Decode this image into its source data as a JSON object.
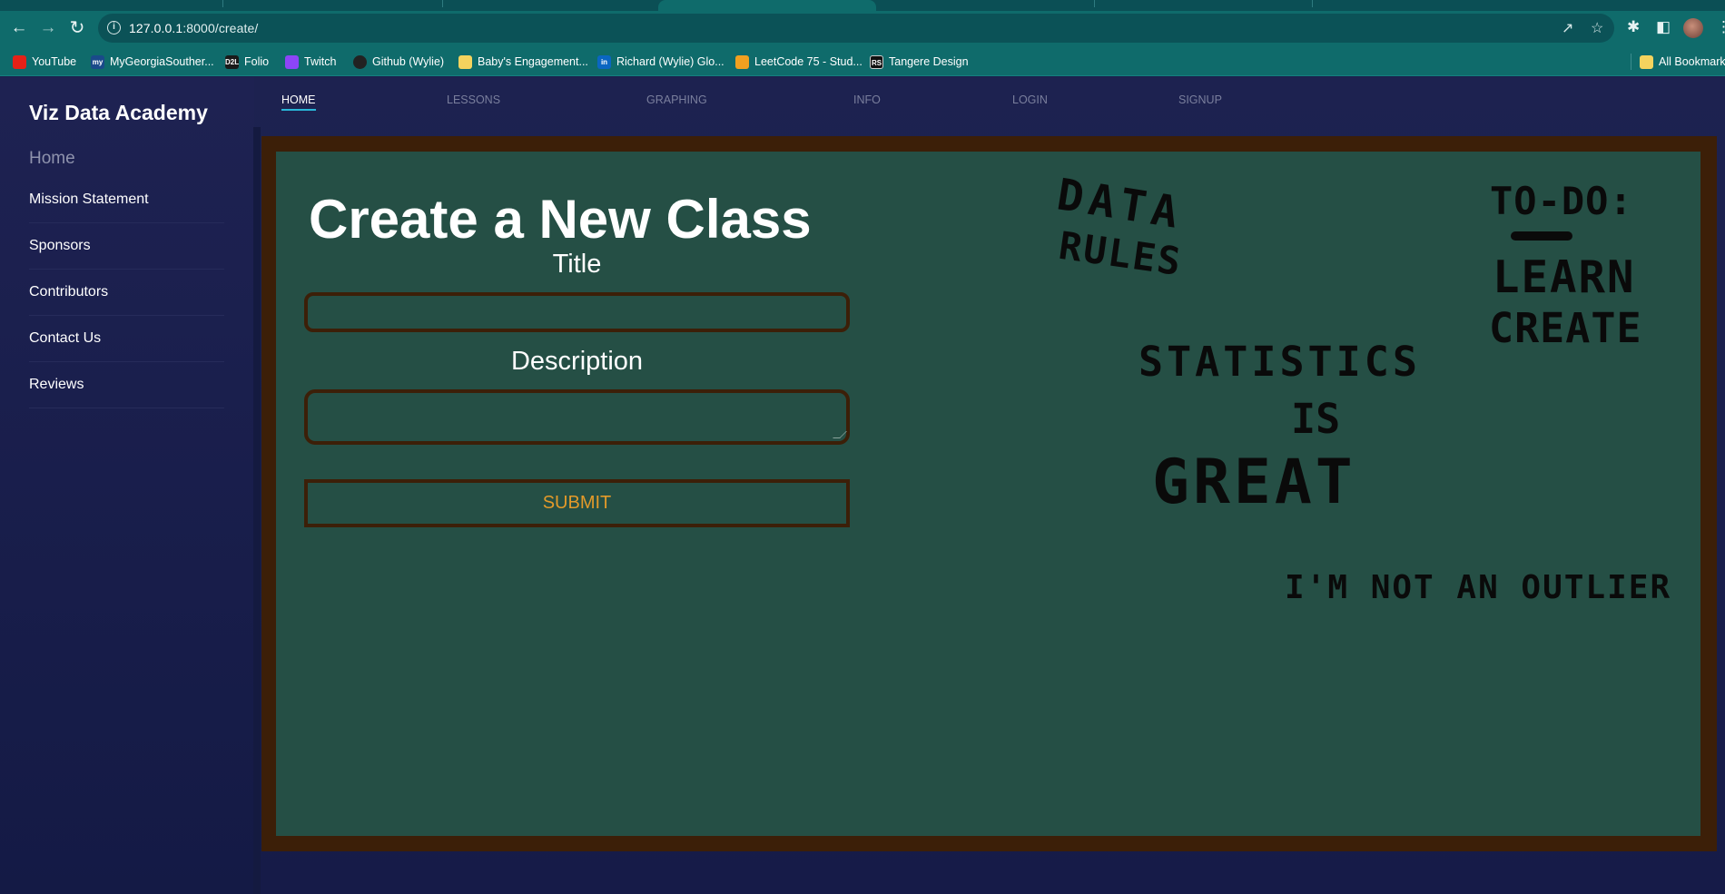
{
  "browser": {
    "url_host": "127.0.0.1",
    "url_path": ":8000/create/",
    "bookmarks": [
      {
        "label": "YouTube",
        "icon": "youtube-icon",
        "color": "#e62117"
      },
      {
        "label": "MyGeorgiaSouther...",
        "icon": "my-icon",
        "color": "#1a4a8a"
      },
      {
        "label": "Folio",
        "icon": "d2l-icon",
        "color": "#1a1a1a"
      },
      {
        "label": "Twitch",
        "icon": "twitch-icon",
        "color": "#8c45f7"
      },
      {
        "label": "Github (Wylie)",
        "icon": "github-icon",
        "color": "#222222"
      },
      {
        "label": "Baby's Engagement...",
        "icon": "folder-icon",
        "color": "#f4d35e"
      },
      {
        "label": "Richard (Wylie) Glo...",
        "icon": "linkedin-icon",
        "color": "#0a66c2"
      },
      {
        "label": "LeetCode 75 - Stud...",
        "icon": "leetcode-icon",
        "color": "#f0a020"
      },
      {
        "label": "Tangere Design",
        "icon": "tangere-icon",
        "color": "#111111"
      }
    ],
    "all_bookmarks": "All Bookmarks"
  },
  "sidebar": {
    "brand": "Viz Data Academy",
    "items": [
      "Home",
      "Mission Statement",
      "Sponsors",
      "Contributors",
      "Contact Us",
      "Reviews"
    ]
  },
  "nav": {
    "links": [
      "HOME",
      "LESSONS",
      "GRAPHING",
      "INFO",
      "LOGIN",
      "SIGNUP"
    ],
    "active": "HOME"
  },
  "form": {
    "heading": "Create a New Class",
    "title_label": "Title",
    "title_value": "",
    "description_label": "Description",
    "description_value": "",
    "submit_label": "SUBMIT"
  },
  "chalkboard": {
    "data_rules_1": "DATA",
    "data_rules_2": "RULES",
    "todo_title": "TO-DO:",
    "todo_line_1": "LEARN",
    "todo_line_2": "CREATE",
    "stat_1": "STATISTICS",
    "stat_2": "IS",
    "stat_3": "GREAT",
    "outlier": "I'M NOT AN OUTLIER"
  },
  "colors": {
    "chrome": "#0f6b6b",
    "board": "#254f45",
    "frame": "#3c1f08",
    "accent": "#29b6d8",
    "submit_text": "#e39a2a"
  }
}
